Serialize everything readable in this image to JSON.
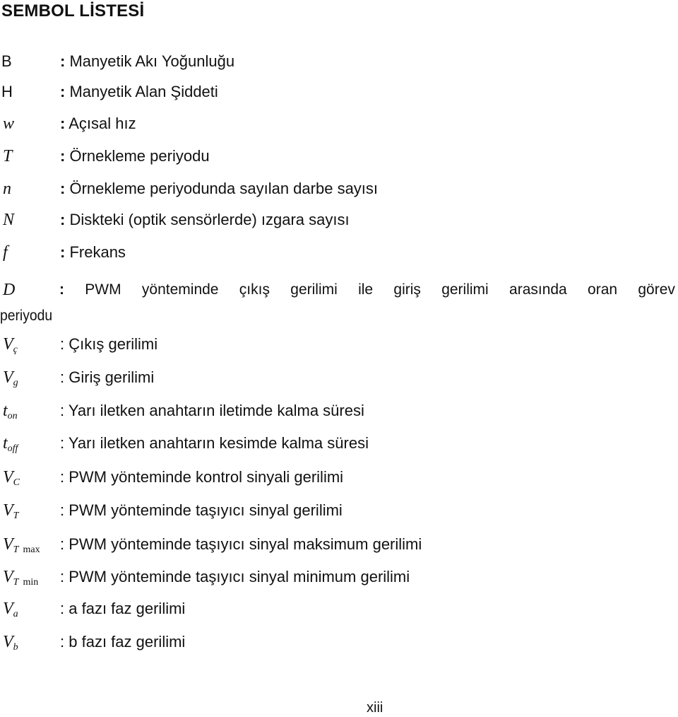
{
  "title": "SEMBOL LİSTESİ",
  "symbols": [
    {
      "symbol": "B",
      "sub": "",
      "colon": ":",
      "description": "Manyetik Akı Yoğunluğu"
    },
    {
      "symbol": "H",
      "sub": "",
      "colon": ":",
      "description": "Manyetik Alan Şiddeti"
    },
    {
      "symbol": "w",
      "sub": "",
      "colon": ":",
      "description": "Açısal hız"
    },
    {
      "symbol": "T",
      "sub": "",
      "colon": ":",
      "description": "Örnekleme periyodu"
    },
    {
      "symbol": "n",
      "sub": "",
      "colon": ":",
      "description": "Örnekleme periyodunda sayılan darbe sayısı"
    },
    {
      "symbol": "N",
      "sub": "",
      "colon": ":",
      "description": "Diskteki (optik sensörlerde) ızgara sayısı"
    },
    {
      "symbol": "f",
      "sub": "",
      "colon": ":",
      "description": "Frekans"
    },
    {
      "symbol": "D",
      "sub": "",
      "colon": ":",
      "description_words": [
        "PWM",
        "yönteminde",
        "çıkış",
        "gerilimi",
        "ile",
        "giriş",
        "gerilimi",
        "arasında",
        "oran",
        "görev"
      ],
      "description_continued": "periyodu"
    },
    {
      "symbol": "V",
      "sub": "ç",
      "colon": ":",
      "description": "Çıkış gerilimi"
    },
    {
      "symbol": "V",
      "sub": "g",
      "colon": ":",
      "description": "Giriş gerilimi"
    },
    {
      "symbol": "t",
      "sub": "on",
      "colon": ":",
      "description": "Yarı iletken anahtarın iletimde kalma süresi"
    },
    {
      "symbol": "t",
      "sub": "off",
      "colon": ":",
      "description": "Yarı iletken anahtarın kesimde kalma süresi"
    },
    {
      "symbol": "V",
      "sub": "C",
      "colon": ":",
      "description": " PWM yönteminde kontrol sinyali gerilimi"
    },
    {
      "symbol": "V",
      "sub": "T",
      "colon": ":",
      "description": "PWM yönteminde taşıyıcı sinyal gerilimi"
    },
    {
      "symbol": "V",
      "sub": "T",
      "sub2": "max",
      "colon": ":",
      "description": "PWM yönteminde taşıyıcı sinyal maksimum gerilimi"
    },
    {
      "symbol": "V",
      "sub": "T",
      "sub2": "min",
      "colon": ":",
      "description": "PWM yönteminde taşıyıcı sinyal minimum gerilimi"
    },
    {
      "symbol": "V",
      "sub": "a",
      "colon": ":",
      "description": "a fazı faz gerilimi"
    },
    {
      "symbol": "V",
      "sub": "b",
      "colon": ":",
      "description": "b fazı faz gerilimi"
    }
  ],
  "page_number": "xiii"
}
